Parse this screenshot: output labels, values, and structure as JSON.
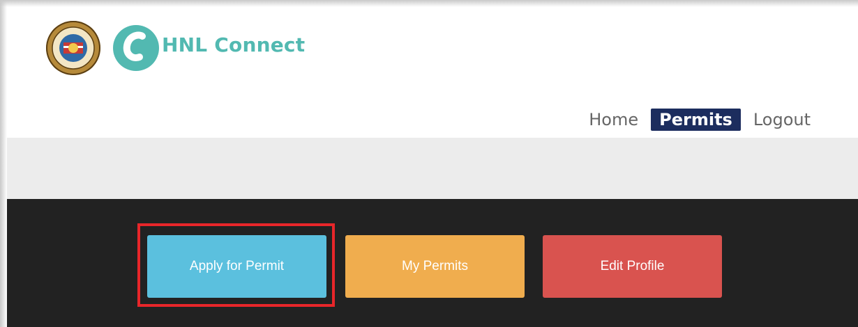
{
  "header": {
    "brand_name": "HNL Connect",
    "seal_alt": "City and County of Honolulu seal"
  },
  "nav": {
    "items": [
      {
        "label": "Home",
        "active": false
      },
      {
        "label": "Permits",
        "active": true
      },
      {
        "label": "Logout",
        "active": false
      }
    ]
  },
  "actions": {
    "apply_label": "Apply for Permit",
    "my_permits_label": "My Permits",
    "edit_profile_label": "Edit Profile"
  },
  "colors": {
    "brand_teal": "#52b9b1",
    "nav_active_bg": "#1c2d5e",
    "apply_bg": "#5bc0de",
    "my_permits_bg": "#f0ad4e",
    "edit_profile_bg": "#d9534f",
    "highlight_border": "#e8262a"
  },
  "icons": {
    "seal": "city-seal-icon",
    "brand": "hnl-connect-logo-icon"
  }
}
